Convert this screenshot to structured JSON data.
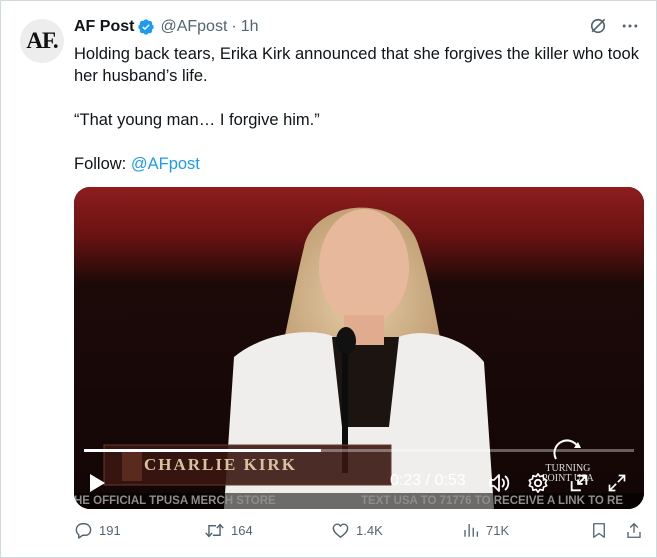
{
  "author": {
    "avatar_text": "AF.",
    "name": "AF Post",
    "handle": "@AFpost",
    "separator": "·",
    "time": "1h"
  },
  "tweet": {
    "line1": "Holding back tears, Erika Kirk announced that she forgives the killer who took her husband’s life.",
    "quote": "“That young man… I forgive him.”",
    "follow_label": "Follow: ",
    "follow_link": "@AFpost"
  },
  "video": {
    "banner_name": "CHARLIE KIRK",
    "time_code": "0:23 / 0:53",
    "progress_fraction": 0.43,
    "watermark_line1": "TURNING",
    "watermark_line2": "POINT USA",
    "ticker_left": "HE OFFICIAL TPUSA MERCH STORE",
    "ticker_right": "TEXT USA TO 71776 TO RECEIVE A LINK TO RE"
  },
  "actions": {
    "replies": "191",
    "reposts": "164",
    "likes": "1.4K",
    "views": "71K"
  },
  "colors": {
    "accent": "#1d9bf0",
    "muted": "#536471",
    "verified": "#1d9bf0"
  }
}
